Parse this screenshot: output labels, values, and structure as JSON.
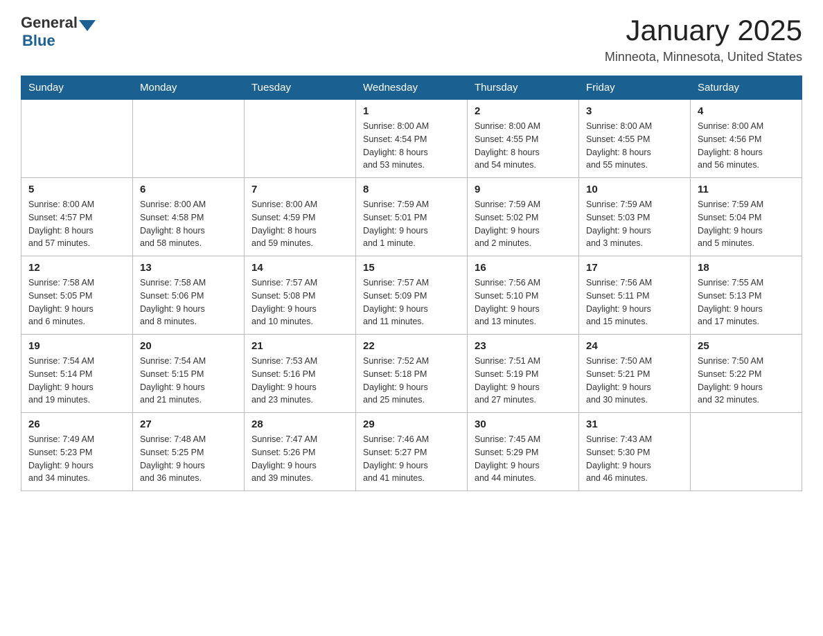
{
  "logo": {
    "text_general": "General",
    "text_blue": "Blue"
  },
  "header": {
    "title": "January 2025",
    "subtitle": "Minneota, Minnesota, United States"
  },
  "weekdays": [
    "Sunday",
    "Monday",
    "Tuesday",
    "Wednesday",
    "Thursday",
    "Friday",
    "Saturday"
  ],
  "weeks": [
    [
      {
        "day": "",
        "info": ""
      },
      {
        "day": "",
        "info": ""
      },
      {
        "day": "",
        "info": ""
      },
      {
        "day": "1",
        "info": "Sunrise: 8:00 AM\nSunset: 4:54 PM\nDaylight: 8 hours\nand 53 minutes."
      },
      {
        "day": "2",
        "info": "Sunrise: 8:00 AM\nSunset: 4:55 PM\nDaylight: 8 hours\nand 54 minutes."
      },
      {
        "day": "3",
        "info": "Sunrise: 8:00 AM\nSunset: 4:55 PM\nDaylight: 8 hours\nand 55 minutes."
      },
      {
        "day": "4",
        "info": "Sunrise: 8:00 AM\nSunset: 4:56 PM\nDaylight: 8 hours\nand 56 minutes."
      }
    ],
    [
      {
        "day": "5",
        "info": "Sunrise: 8:00 AM\nSunset: 4:57 PM\nDaylight: 8 hours\nand 57 minutes."
      },
      {
        "day": "6",
        "info": "Sunrise: 8:00 AM\nSunset: 4:58 PM\nDaylight: 8 hours\nand 58 minutes."
      },
      {
        "day": "7",
        "info": "Sunrise: 8:00 AM\nSunset: 4:59 PM\nDaylight: 8 hours\nand 59 minutes."
      },
      {
        "day": "8",
        "info": "Sunrise: 7:59 AM\nSunset: 5:01 PM\nDaylight: 9 hours\nand 1 minute."
      },
      {
        "day": "9",
        "info": "Sunrise: 7:59 AM\nSunset: 5:02 PM\nDaylight: 9 hours\nand 2 minutes."
      },
      {
        "day": "10",
        "info": "Sunrise: 7:59 AM\nSunset: 5:03 PM\nDaylight: 9 hours\nand 3 minutes."
      },
      {
        "day": "11",
        "info": "Sunrise: 7:59 AM\nSunset: 5:04 PM\nDaylight: 9 hours\nand 5 minutes."
      }
    ],
    [
      {
        "day": "12",
        "info": "Sunrise: 7:58 AM\nSunset: 5:05 PM\nDaylight: 9 hours\nand 6 minutes."
      },
      {
        "day": "13",
        "info": "Sunrise: 7:58 AM\nSunset: 5:06 PM\nDaylight: 9 hours\nand 8 minutes."
      },
      {
        "day": "14",
        "info": "Sunrise: 7:57 AM\nSunset: 5:08 PM\nDaylight: 9 hours\nand 10 minutes."
      },
      {
        "day": "15",
        "info": "Sunrise: 7:57 AM\nSunset: 5:09 PM\nDaylight: 9 hours\nand 11 minutes."
      },
      {
        "day": "16",
        "info": "Sunrise: 7:56 AM\nSunset: 5:10 PM\nDaylight: 9 hours\nand 13 minutes."
      },
      {
        "day": "17",
        "info": "Sunrise: 7:56 AM\nSunset: 5:11 PM\nDaylight: 9 hours\nand 15 minutes."
      },
      {
        "day": "18",
        "info": "Sunrise: 7:55 AM\nSunset: 5:13 PM\nDaylight: 9 hours\nand 17 minutes."
      }
    ],
    [
      {
        "day": "19",
        "info": "Sunrise: 7:54 AM\nSunset: 5:14 PM\nDaylight: 9 hours\nand 19 minutes."
      },
      {
        "day": "20",
        "info": "Sunrise: 7:54 AM\nSunset: 5:15 PM\nDaylight: 9 hours\nand 21 minutes."
      },
      {
        "day": "21",
        "info": "Sunrise: 7:53 AM\nSunset: 5:16 PM\nDaylight: 9 hours\nand 23 minutes."
      },
      {
        "day": "22",
        "info": "Sunrise: 7:52 AM\nSunset: 5:18 PM\nDaylight: 9 hours\nand 25 minutes."
      },
      {
        "day": "23",
        "info": "Sunrise: 7:51 AM\nSunset: 5:19 PM\nDaylight: 9 hours\nand 27 minutes."
      },
      {
        "day": "24",
        "info": "Sunrise: 7:50 AM\nSunset: 5:21 PM\nDaylight: 9 hours\nand 30 minutes."
      },
      {
        "day": "25",
        "info": "Sunrise: 7:50 AM\nSunset: 5:22 PM\nDaylight: 9 hours\nand 32 minutes."
      }
    ],
    [
      {
        "day": "26",
        "info": "Sunrise: 7:49 AM\nSunset: 5:23 PM\nDaylight: 9 hours\nand 34 minutes."
      },
      {
        "day": "27",
        "info": "Sunrise: 7:48 AM\nSunset: 5:25 PM\nDaylight: 9 hours\nand 36 minutes."
      },
      {
        "day": "28",
        "info": "Sunrise: 7:47 AM\nSunset: 5:26 PM\nDaylight: 9 hours\nand 39 minutes."
      },
      {
        "day": "29",
        "info": "Sunrise: 7:46 AM\nSunset: 5:27 PM\nDaylight: 9 hours\nand 41 minutes."
      },
      {
        "day": "30",
        "info": "Sunrise: 7:45 AM\nSunset: 5:29 PM\nDaylight: 9 hours\nand 44 minutes."
      },
      {
        "day": "31",
        "info": "Sunrise: 7:43 AM\nSunset: 5:30 PM\nDaylight: 9 hours\nand 46 minutes."
      },
      {
        "day": "",
        "info": ""
      }
    ]
  ]
}
